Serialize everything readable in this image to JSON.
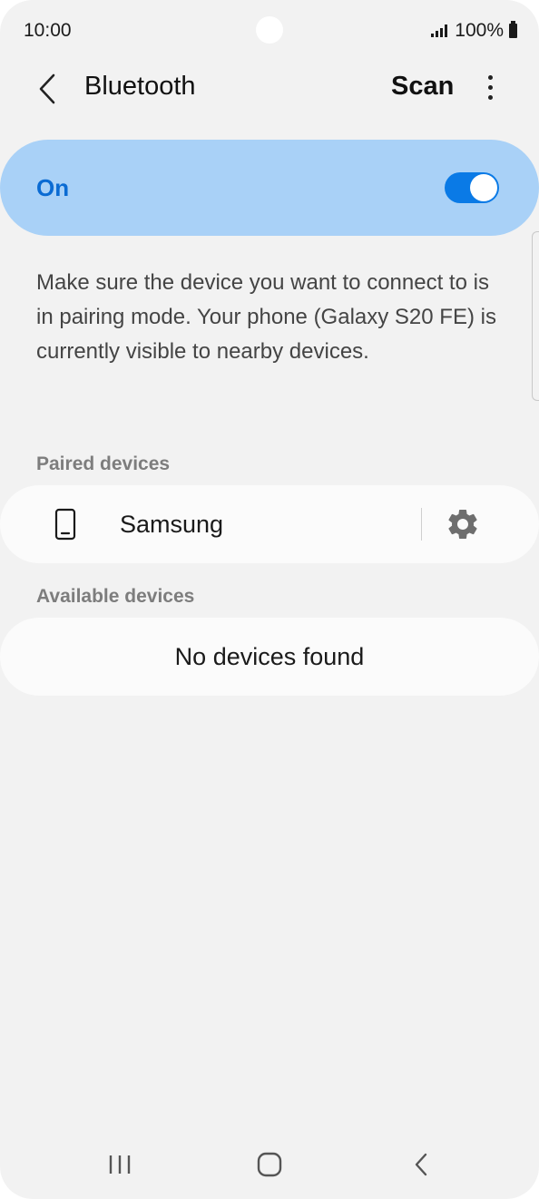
{
  "status_bar": {
    "time": "10:00",
    "battery_text": "100%"
  },
  "app_bar": {
    "title": "Bluetooth",
    "scan_label": "Scan",
    "icons": {
      "back": "back-arrow-icon",
      "more": "more-options-icon"
    }
  },
  "bluetooth_toggle": {
    "label": "On",
    "state": "on",
    "accent_color": "#0a7ae6",
    "card_color": "#a9d1f7"
  },
  "description": "Make sure the device you want to connect to is in pairing mode. Your phone (Galaxy S20 FE) is currently visible to nearby devices.",
  "paired_devices": {
    "header": "Paired devices",
    "items": [
      {
        "name": "Samsung",
        "icon": "phone-icon",
        "action_icon": "gear-icon"
      }
    ]
  },
  "available_devices": {
    "header": "Available devices",
    "empty_text": "No devices found"
  },
  "nav_bar": {
    "icons": [
      "recents-icon",
      "home-icon",
      "back-icon"
    ]
  }
}
